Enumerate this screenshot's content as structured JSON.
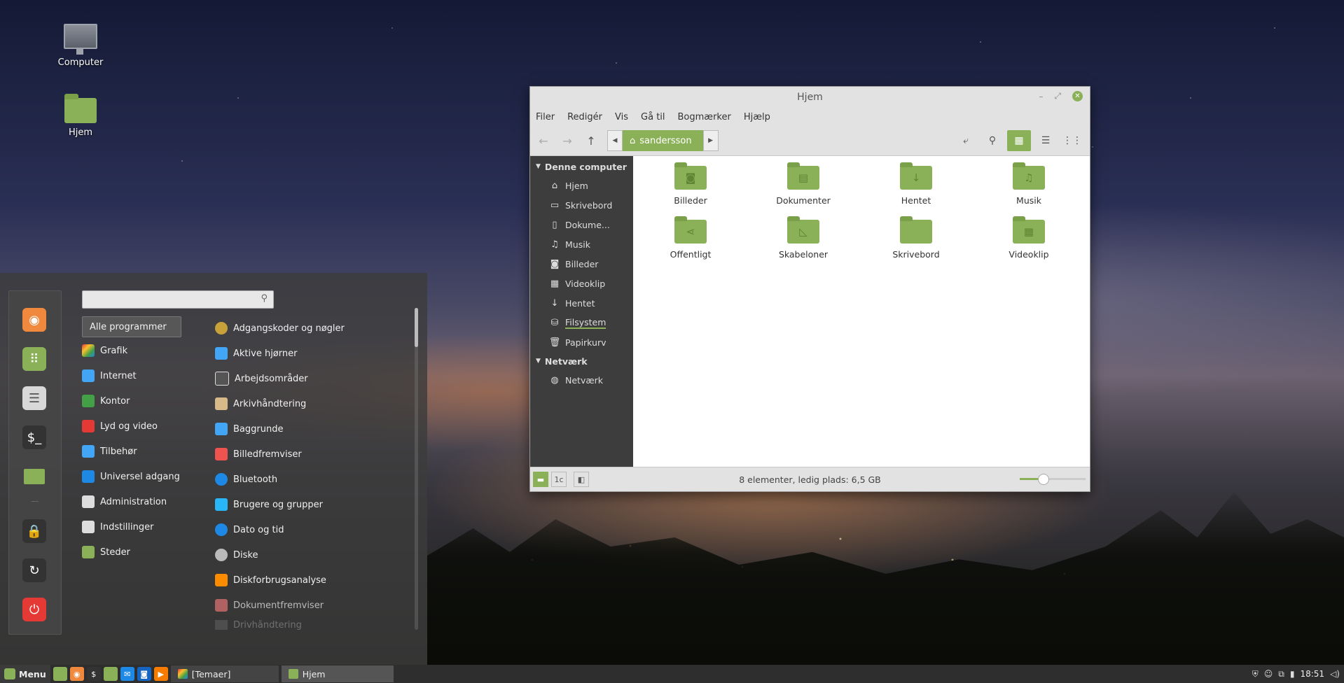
{
  "desktop": {
    "icons": [
      {
        "label": "Computer"
      },
      {
        "label": "Hjem"
      }
    ]
  },
  "start_menu": {
    "search_placeholder": "",
    "favorites": [
      {
        "name": "firefox-icon",
        "color": "#f0883e"
      },
      {
        "name": "software-manager-icon",
        "color": "#8bb158"
      },
      {
        "name": "settings-icon",
        "color": "#d8d8d8"
      },
      {
        "name": "terminal-icon",
        "color": "#333333"
      },
      {
        "name": "files-icon",
        "color": "#8bb158"
      },
      {
        "name": "lock-icon",
        "color": "#333333"
      },
      {
        "name": "logout-icon",
        "color": "#333333"
      },
      {
        "name": "power-icon",
        "color": "#e53935"
      }
    ],
    "categories": [
      {
        "label": "Alle programmer"
      },
      {
        "label": "Grafik"
      },
      {
        "label": "Internet"
      },
      {
        "label": "Kontor"
      },
      {
        "label": "Lyd og video"
      },
      {
        "label": "Tilbehør"
      },
      {
        "label": "Universel adgang"
      },
      {
        "label": "Administration"
      },
      {
        "label": "Indstillinger"
      },
      {
        "label": "Steder"
      }
    ],
    "apps": [
      {
        "label": "Adgangskoder og nøgler"
      },
      {
        "label": "Aktive hjørner"
      },
      {
        "label": "Arbejdsområder"
      },
      {
        "label": "Arkivhåndtering"
      },
      {
        "label": "Baggrunde"
      },
      {
        "label": "Billedfremviser"
      },
      {
        "label": "Bluetooth"
      },
      {
        "label": "Brugere og grupper"
      },
      {
        "label": "Dato og tid"
      },
      {
        "label": "Diske"
      },
      {
        "label": "Diskforbrugsanalyse"
      },
      {
        "label": "Dokumentfremviser"
      },
      {
        "label": "Drivhåndtering"
      }
    ]
  },
  "window": {
    "title": "Hjem",
    "menus": [
      "Filer",
      "Redigér",
      "Vis",
      "Gå til",
      "Bogmærker",
      "Hjælp"
    ],
    "breadcrumb": "sandersson",
    "sidebar": {
      "sections": [
        {
          "title": "Denne computer",
          "items": [
            {
              "label": "Hjem",
              "icon": "⌂"
            },
            {
              "label": "Skrivebord",
              "icon": "▭"
            },
            {
              "label": "Dokume...",
              "icon": "▯"
            },
            {
              "label": "Musik",
              "icon": "♫"
            },
            {
              "label": "Billeder",
              "icon": "◙"
            },
            {
              "label": "Videoklip",
              "icon": "▦"
            },
            {
              "label": "Hentet",
              "icon": "↓"
            },
            {
              "label": "Filsystem",
              "icon": "⛁"
            },
            {
              "label": "Papirkurv",
              "icon": "🗑"
            }
          ]
        },
        {
          "title": "Netværk",
          "items": [
            {
              "label": "Netværk",
              "icon": "◍"
            }
          ]
        }
      ]
    },
    "files": [
      {
        "label": "Billeder",
        "icon": "◙"
      },
      {
        "label": "Dokumenter",
        "icon": "▤"
      },
      {
        "label": "Hentet",
        "icon": "↓"
      },
      {
        "label": "Musik",
        "icon": "♫"
      },
      {
        "label": "Offentligt",
        "icon": "⋖"
      },
      {
        "label": "Skabeloner",
        "icon": "◺"
      },
      {
        "label": "Skrivebord",
        "icon": ""
      },
      {
        "label": "Videoklip",
        "icon": "▦"
      }
    ],
    "status": "8 elementer, ledig plads: 6,5 GB",
    "zoom_level": 0.35
  },
  "taskbar": {
    "menu_label": "Menu",
    "tasks": [
      {
        "label": "[Temaer]"
      },
      {
        "label": "Hjem"
      }
    ],
    "clock": "18:51"
  },
  "colors": {
    "accent": "#8bb158"
  }
}
